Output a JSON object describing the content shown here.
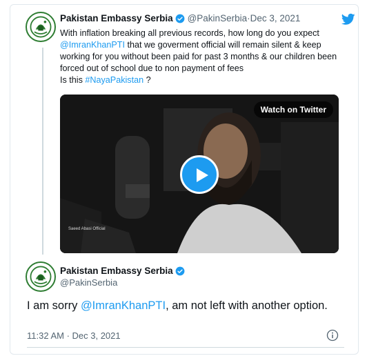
{
  "tweet": {
    "author_name": "Pakistan Embassy Serbia",
    "handle": "@PakinSerbia",
    "separator": " · ",
    "date": "Dec 3, 2021",
    "text_1": "With inflation breaking all previous records, how long do you expect",
    "mention": "@ImranKhanPTI",
    "text_2": " that we goverment official will remain silent & keep working for you without been paid for past 3 months & our children been forced out of school due to non payment of fees",
    "text_3": "Is this ",
    "hashtag": "#NayaPakistan",
    "text_4": " ?",
    "media": {
      "watch_label": "Watch on Twitter",
      "watermark": "Saeed Abasi Official",
      "play_icon": "play-icon"
    }
  },
  "reply": {
    "author_name": "Pakistan Embassy Serbia",
    "handle": "@PakinSerbia",
    "text_1": "I am sorry ",
    "mention": "@ImranKhanPTI",
    "text_2": ", am not left with another option.",
    "timestamp": "11:32 AM · Dec 3, 2021"
  },
  "icons": {
    "brand": "twitter-bird-icon",
    "verified": "verified-badge-icon",
    "info": "info-icon"
  },
  "colors": {
    "link": "#1d9bf0",
    "muted": "#536471",
    "text": "#0f1419",
    "avatar_ring": "#2e7d32"
  }
}
